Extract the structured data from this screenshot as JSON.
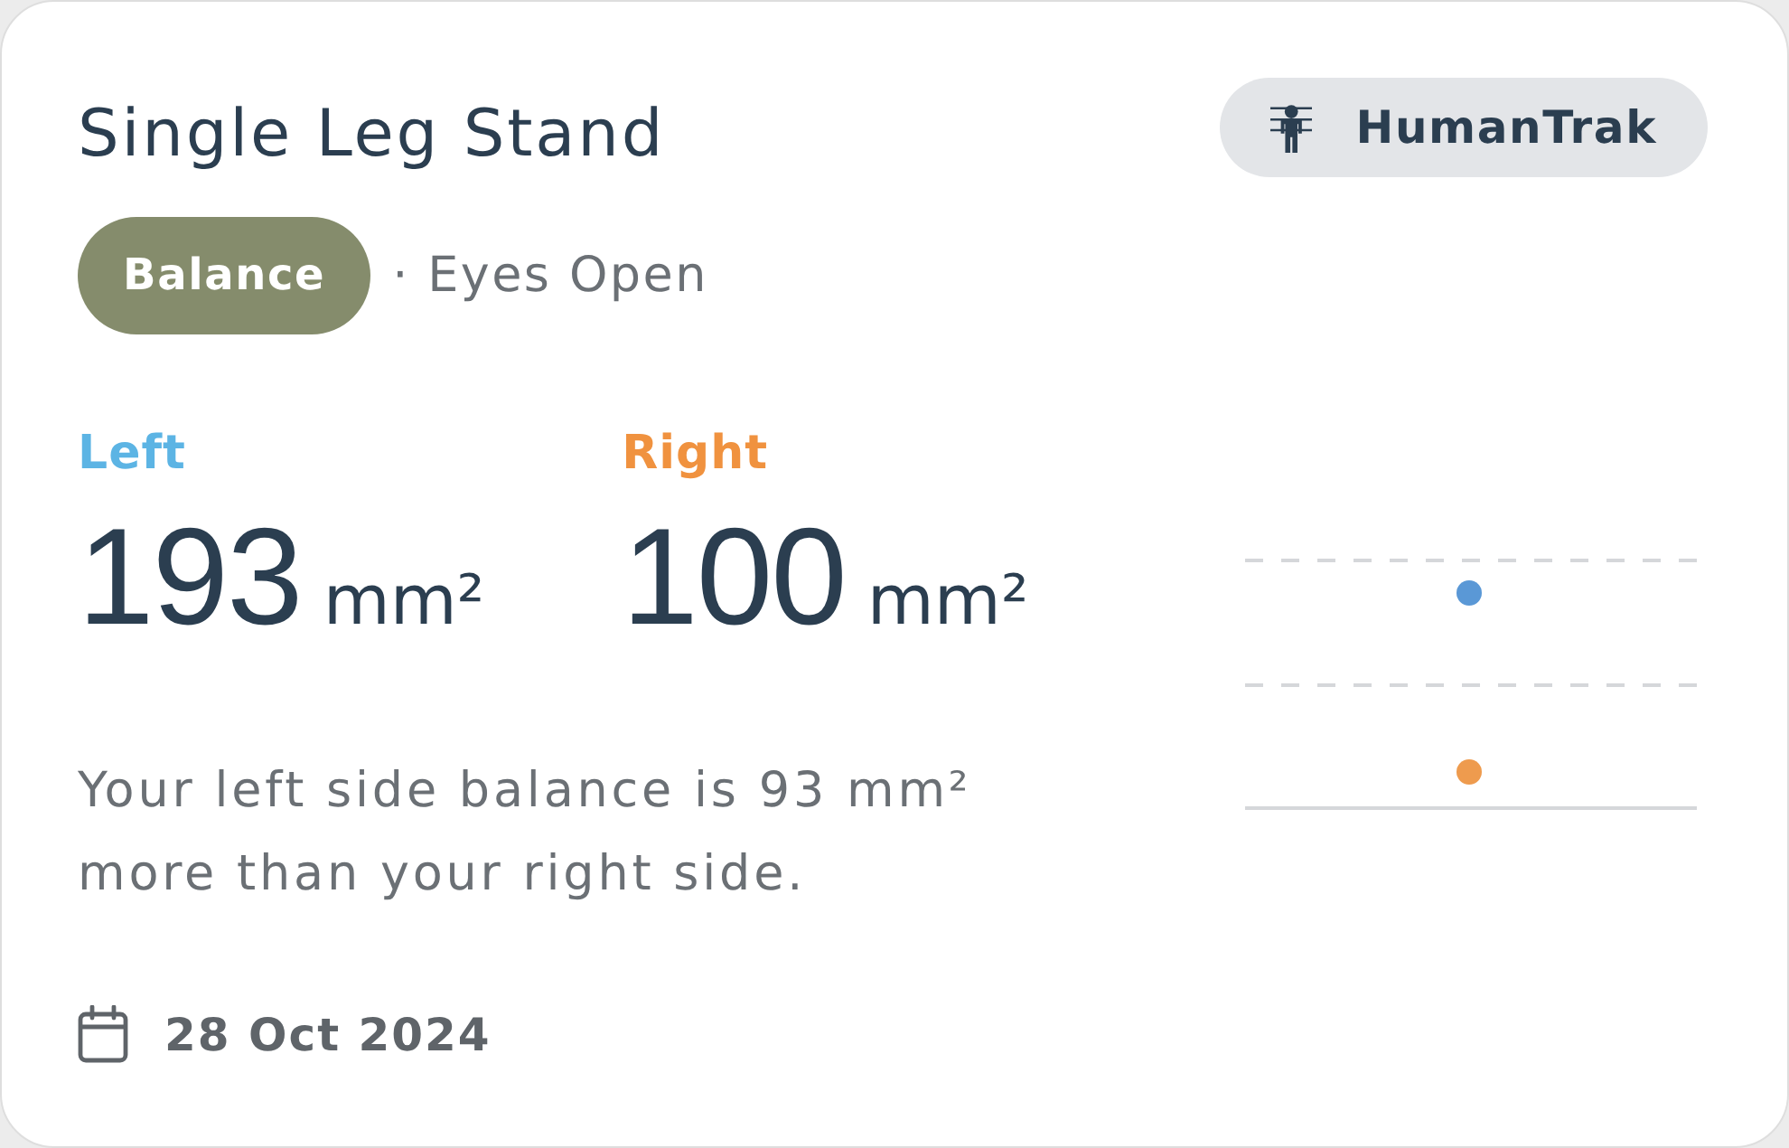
{
  "title": "Single Leg Stand",
  "source_badge": {
    "label": "HumanTrak"
  },
  "tags": {
    "category": "Balance",
    "condition": "· Eyes Open"
  },
  "sides": [
    {
      "label": "Left",
      "value": "193",
      "unit": "mm²",
      "color": "#5cb4e4"
    },
    {
      "label": "Right",
      "value": "100",
      "unit": "mm²",
      "color": "#f0923f"
    }
  ],
  "summary": "Your left side balance is 93 mm² more than your right side.",
  "chart": {
    "points": [
      {
        "color": "#5a98d6"
      },
      {
        "color": "#ee9b4e"
      }
    ]
  },
  "date": "28 Oct 2024"
}
